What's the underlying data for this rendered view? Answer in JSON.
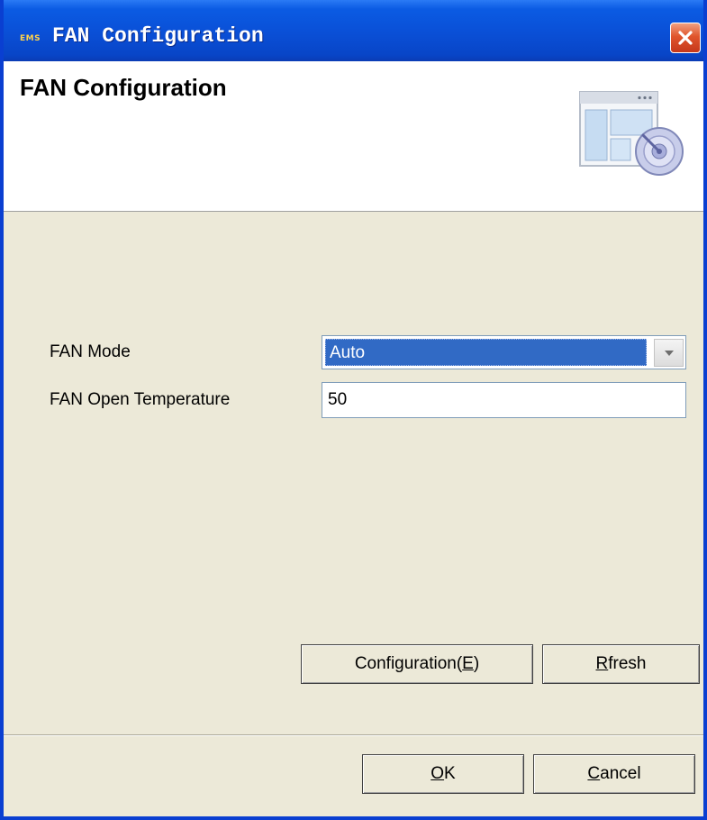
{
  "window": {
    "app_badge": "EMS",
    "title": "FAN Configuration"
  },
  "header": {
    "title": "FAN Configuration",
    "icon": "settings-window-gauge-icon"
  },
  "form": {
    "mode_label": "FAN Mode",
    "mode_value": "Auto",
    "temp_label": "FAN Open Temperature",
    "temp_value": "50"
  },
  "actions": {
    "configuration_label_pre": "Configuration(",
    "configuration_mnemonic": "E",
    "configuration_label_post": ")",
    "refresh_mnemonic": "R",
    "refresh_label_rest": "fresh"
  },
  "footer": {
    "ok_mnemonic": "O",
    "ok_label_rest": "K",
    "cancel_mnemonic": "C",
    "cancel_label_rest": "ancel"
  },
  "colors": {
    "titlebar": "#0a4fd6",
    "selection": "#316ac5",
    "dialog_background": "#ece9d8"
  }
}
